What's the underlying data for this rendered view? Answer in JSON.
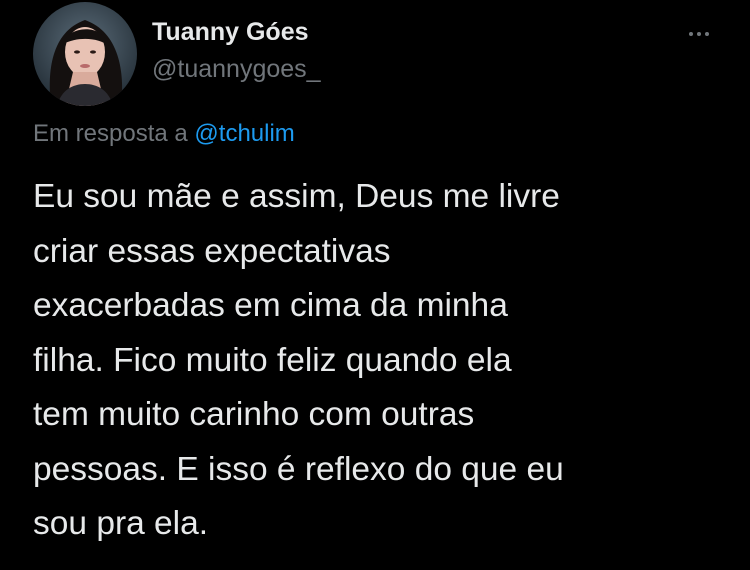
{
  "author": {
    "display_name": "Tuanny Góes",
    "handle": "@tuannygoes_",
    "avatar_icon": "profile-avatar"
  },
  "more_icon": "more-horizontal-icon",
  "reply": {
    "prefix": "Em resposta a",
    "mention": "@tchulim"
  },
  "tweet": {
    "lines": [
      "Eu sou mãe e assim, Deus me livre",
      "criar essas expectativas",
      "exacerbadas em cima da minha",
      "filha. Fico muito feliz quando ela",
      "tem muito carinho com outras",
      "pessoas. E isso é reflexo do que eu",
      "sou pra ela."
    ]
  },
  "colors": {
    "background": "#000000",
    "text": "#e7e9ea",
    "secondary": "#71767b",
    "link": "#1d9bf0"
  }
}
